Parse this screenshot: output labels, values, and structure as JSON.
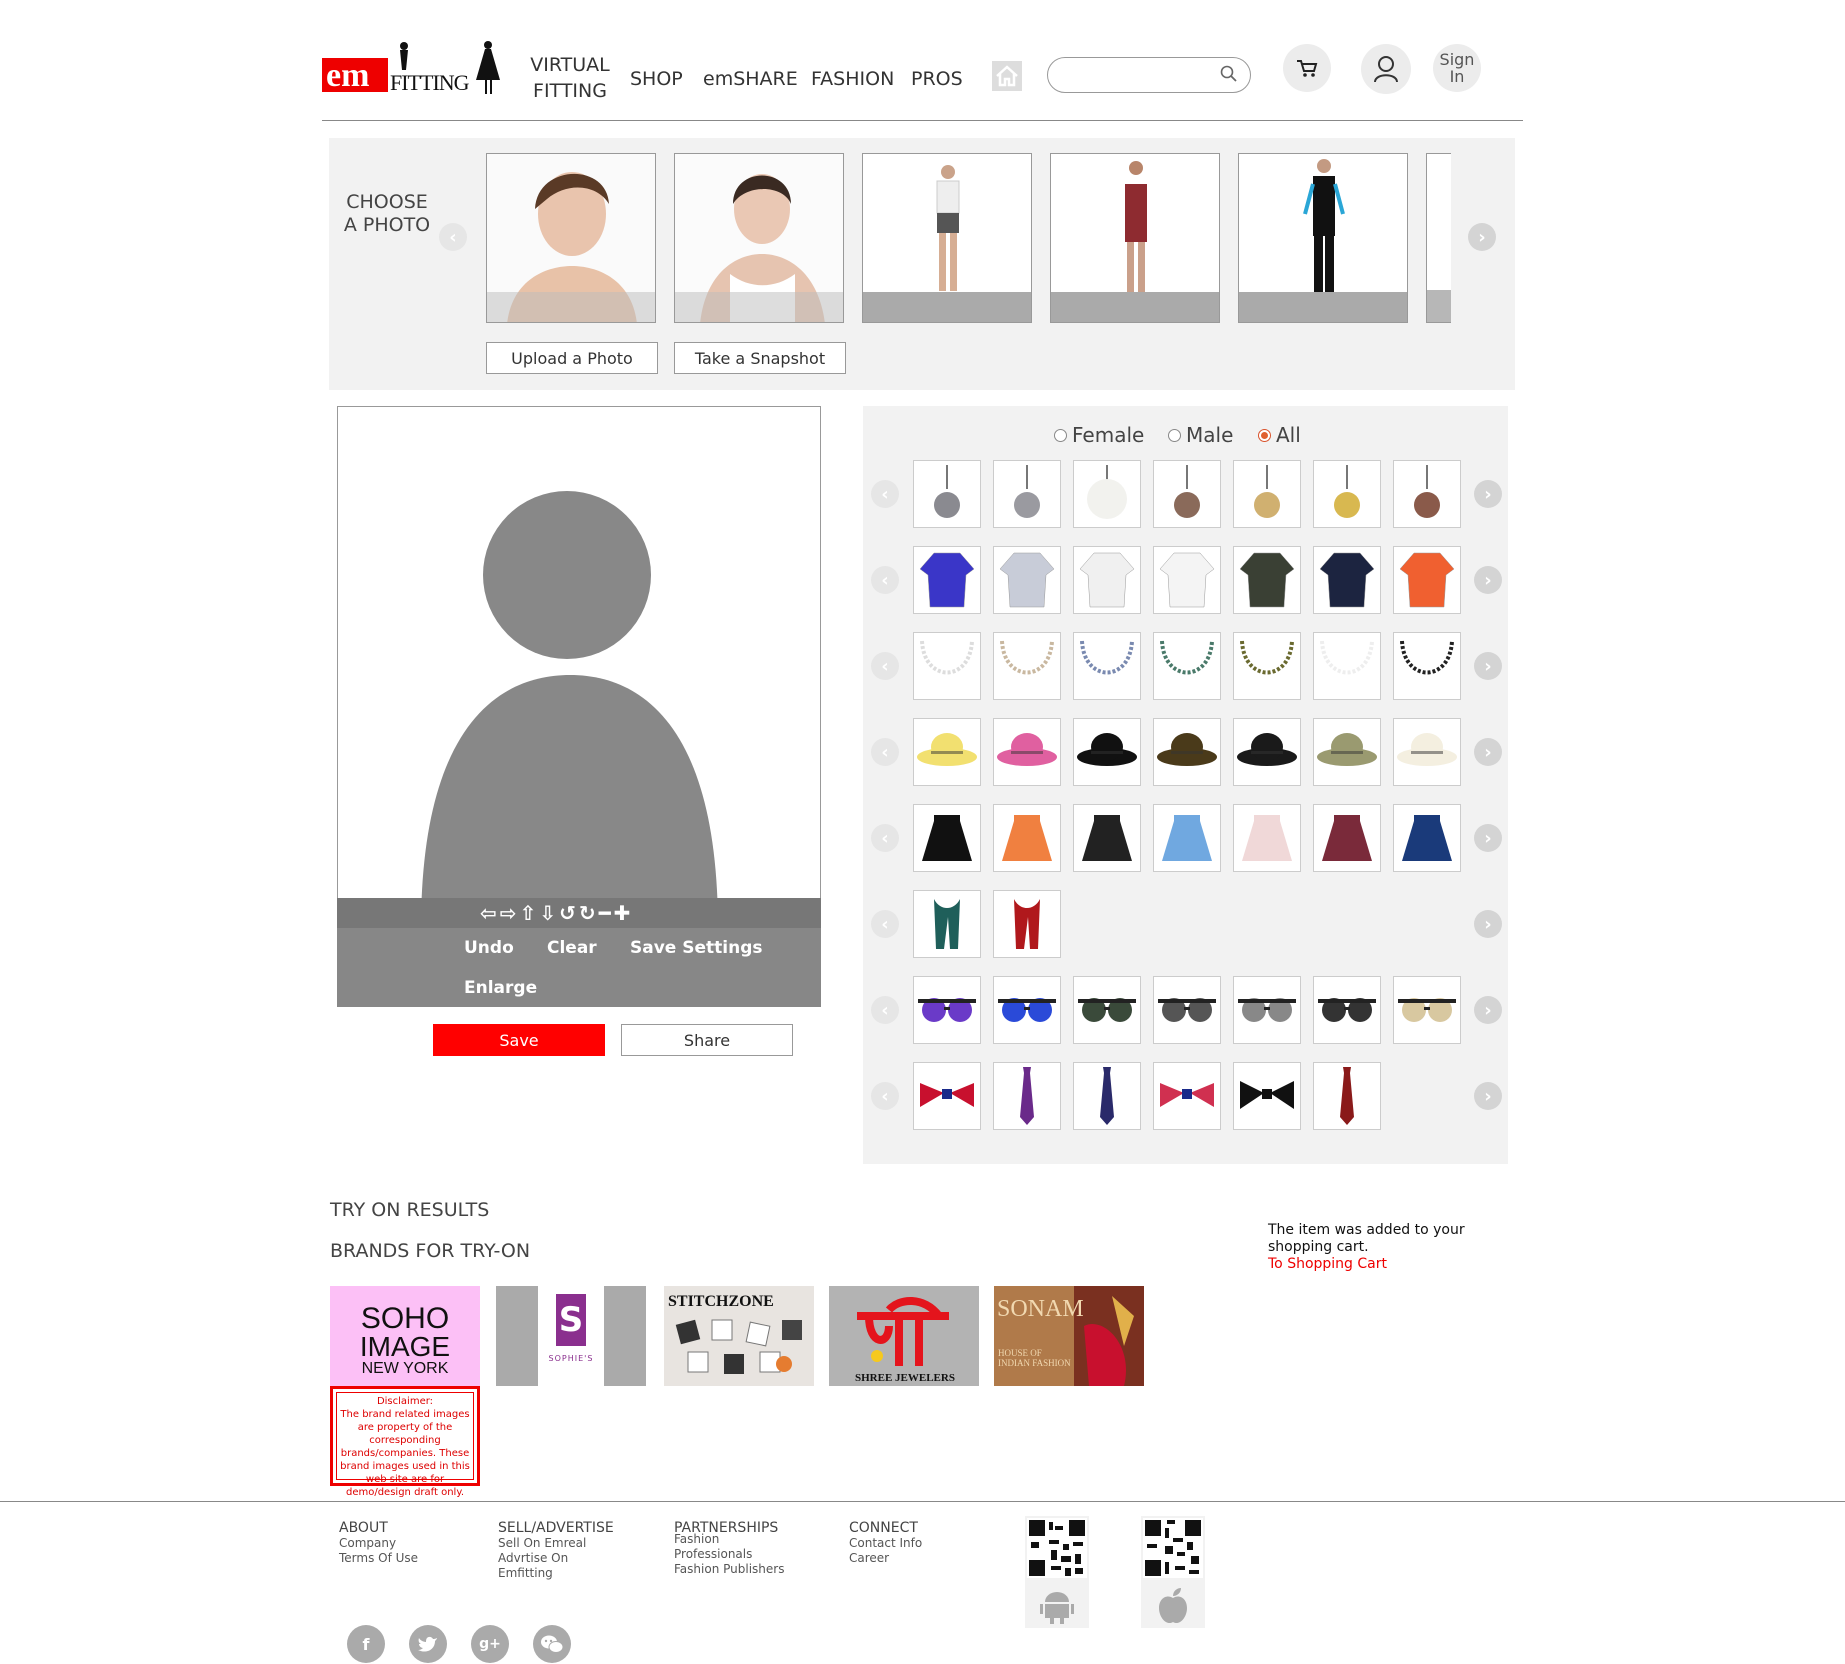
{
  "header": {
    "logo": {
      "em": "em",
      "fitting": "FITTING"
    },
    "nav": [
      {
        "label": "VIRTUAL\nFITTING"
      },
      {
        "label": "SHOP"
      },
      {
        "label": "emSHARE"
      },
      {
        "label": "FASHION"
      },
      {
        "label": "PROS"
      }
    ],
    "search_placeholder": "",
    "sign_in": "Sign In"
  },
  "choose_photo": {
    "label": "CHOOSE A PHOTO",
    "upload_label": "Upload a Photo",
    "snapshot_label": "Take a Snapshot"
  },
  "canvas": {
    "controls": [
      "arrow-left-icon",
      "arrow-right-icon",
      "arrow-up-icon",
      "arrow-down-icon",
      "rotate-left-icon",
      "rotate-right-icon",
      "zoom-out-icon",
      "zoom-in-icon"
    ],
    "undo": "Undo",
    "clear": "Clear",
    "save_settings": "Save Settings",
    "enlarge": "Enlarge",
    "save": "Save",
    "share": "Share"
  },
  "filters": {
    "female": "Female",
    "male": "Male",
    "all": "All",
    "selected": "All"
  },
  "item_rows": [
    {
      "category": "earrings",
      "count": 7
    },
    {
      "category": "tops",
      "count": 7
    },
    {
      "category": "necklaces",
      "count": 7
    },
    {
      "category": "hats",
      "count": 7
    },
    {
      "category": "skirts",
      "count": 7
    },
    {
      "category": "scarves",
      "count": 2
    },
    {
      "category": "sunglasses",
      "count": 7
    },
    {
      "category": "ties",
      "count": 6
    }
  ],
  "results": {
    "try_on_title": "TRY ON RESULTS",
    "brands_title": "BRANDS FOR TRY-ON",
    "brands": [
      {
        "name": "SOHO IMAGE NEW YORK",
        "line1": "SOHO",
        "line2": "IMAGE",
        "line3": "NEW YORK"
      },
      {
        "name": "SOPHIE'S",
        "sub": "SOPHIE'S"
      },
      {
        "name": "STITCHZONE"
      },
      {
        "name": "SHREE JEWELERS"
      },
      {
        "name": "SONAM",
        "sub": "HOUSE OF INDIAN FASHION"
      }
    ],
    "disclaimer_title": "Disclaimer:",
    "disclaimer_text": "The brand related images are property of the corresponding brands/companies. These brand images used in this web site are for demo/design draft only.",
    "cart_message": "The item was added to your shopping cart.",
    "cart_link": "To Shopping Cart"
  },
  "footer": {
    "columns": [
      {
        "title": "ABOUT",
        "links": [
          "Company",
          "Terms Of Use"
        ]
      },
      {
        "title": "SELL/ADVERTISE",
        "links": [
          "Sell On Emreal",
          "Advrtise On",
          "Emfitting"
        ]
      },
      {
        "title": "PARTNERSHIPS",
        "links": [
          "Fashion",
          "Professionals",
          "Fashion Publishers"
        ]
      },
      {
        "title": "CONNECT",
        "links": [
          "Contact Info",
          "Career"
        ]
      }
    ],
    "social": [
      "facebook-icon",
      "twitter-icon",
      "google-plus-icon",
      "wechat-icon"
    ]
  },
  "colors": {
    "accent": "#ff0000",
    "link": "#e00000",
    "panel": "#f2f2f2",
    "gray": "#878787"
  }
}
